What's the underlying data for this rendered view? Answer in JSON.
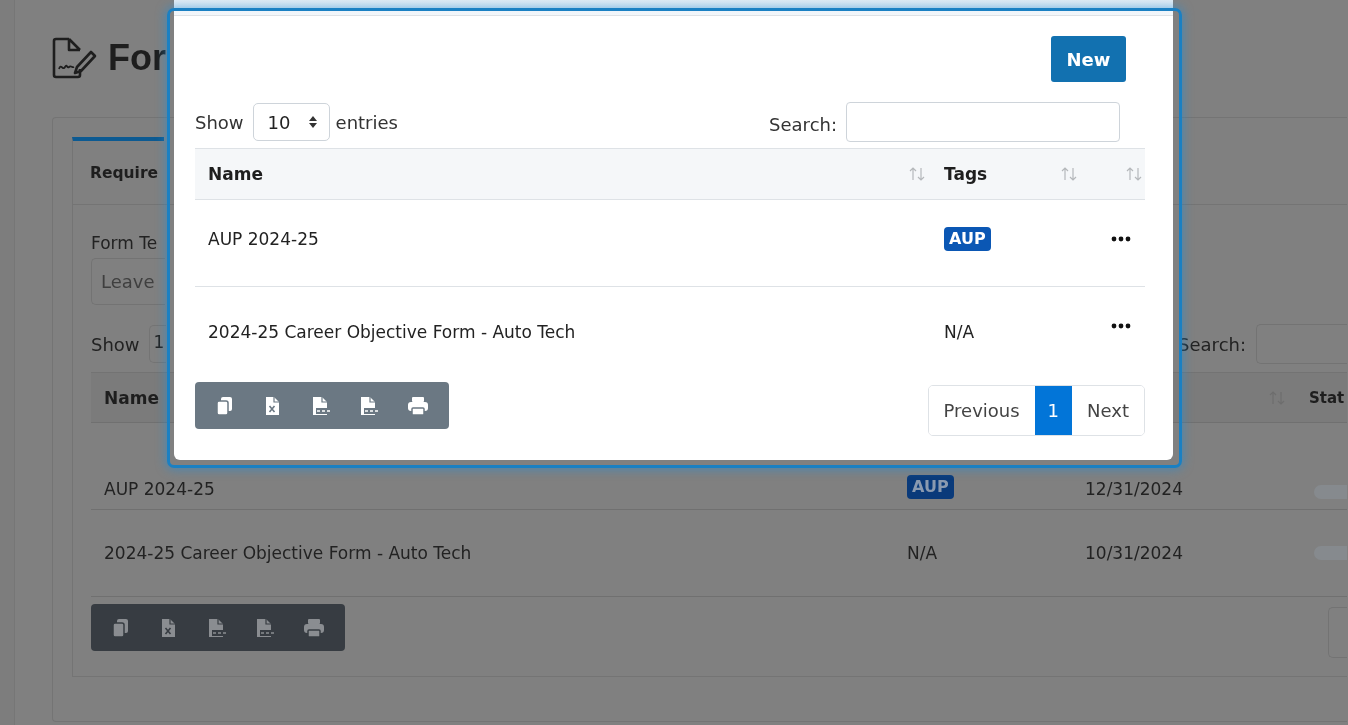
{
  "page": {
    "title": "For",
    "tabs": [
      {
        "label": "Require",
        "selected": true
      }
    ],
    "template_field": {
      "label": "Form Te",
      "placeholder": "Leave"
    },
    "length_menu": {
      "label": "Show",
      "value": "1"
    },
    "search": {
      "label": "Search:"
    },
    "table": {
      "columns": [
        {
          "label": "Name"
        },
        {
          "sortable": true
        },
        {
          "label": "Stat"
        }
      ],
      "rows": [
        {
          "name": "AUP 2024-25",
          "tag": {
            "kind": "badge",
            "label": "AUP"
          },
          "date": "12/31/2024",
          "status": {
            "kind": "bar"
          }
        },
        {
          "name": "2024-25 Career Objective Form - Auto Tech",
          "tag": {
            "kind": "text",
            "label": "N/A"
          },
          "date": "10/31/2024",
          "status": {
            "kind": "bar"
          }
        }
      ]
    },
    "export_buttons": [
      {
        "kind": "copy"
      },
      {
        "kind": "excel"
      },
      {
        "kind": "csv"
      },
      {
        "kind": "pdf"
      },
      {
        "kind": "print"
      }
    ],
    "pagination": {
      "kind": "edge"
    }
  },
  "modal": {
    "new_button": {
      "label": "New"
    },
    "length_menu": {
      "label_before": "Show",
      "value": "10",
      "label_after": "entries"
    },
    "search": {
      "label": "Search:"
    },
    "table": {
      "columns": [
        {
          "label": "Name",
          "sortable": true
        },
        {
          "label": "Tags",
          "sortable": true
        },
        {
          "sortable": true
        }
      ],
      "rows": [
        {
          "name": "AUP 2024-25",
          "tag": {
            "kind": "badge",
            "label": "AUP"
          },
          "actions": {
            "kind": "ellipsis"
          }
        },
        {
          "name": "2024-25 Career Objective Form - Auto Tech",
          "tag": {
            "kind": "text",
            "label": "N/A"
          },
          "actions": {
            "kind": "ellipsis"
          }
        }
      ]
    },
    "export_buttons": [
      {
        "kind": "copy"
      },
      {
        "kind": "excel"
      },
      {
        "kind": "csv"
      },
      {
        "kind": "pdf"
      },
      {
        "kind": "print"
      }
    ],
    "pagination": {
      "previous": "Previous",
      "pages": [
        {
          "label": "1",
          "selected": true
        }
      ],
      "next": "Next"
    }
  }
}
